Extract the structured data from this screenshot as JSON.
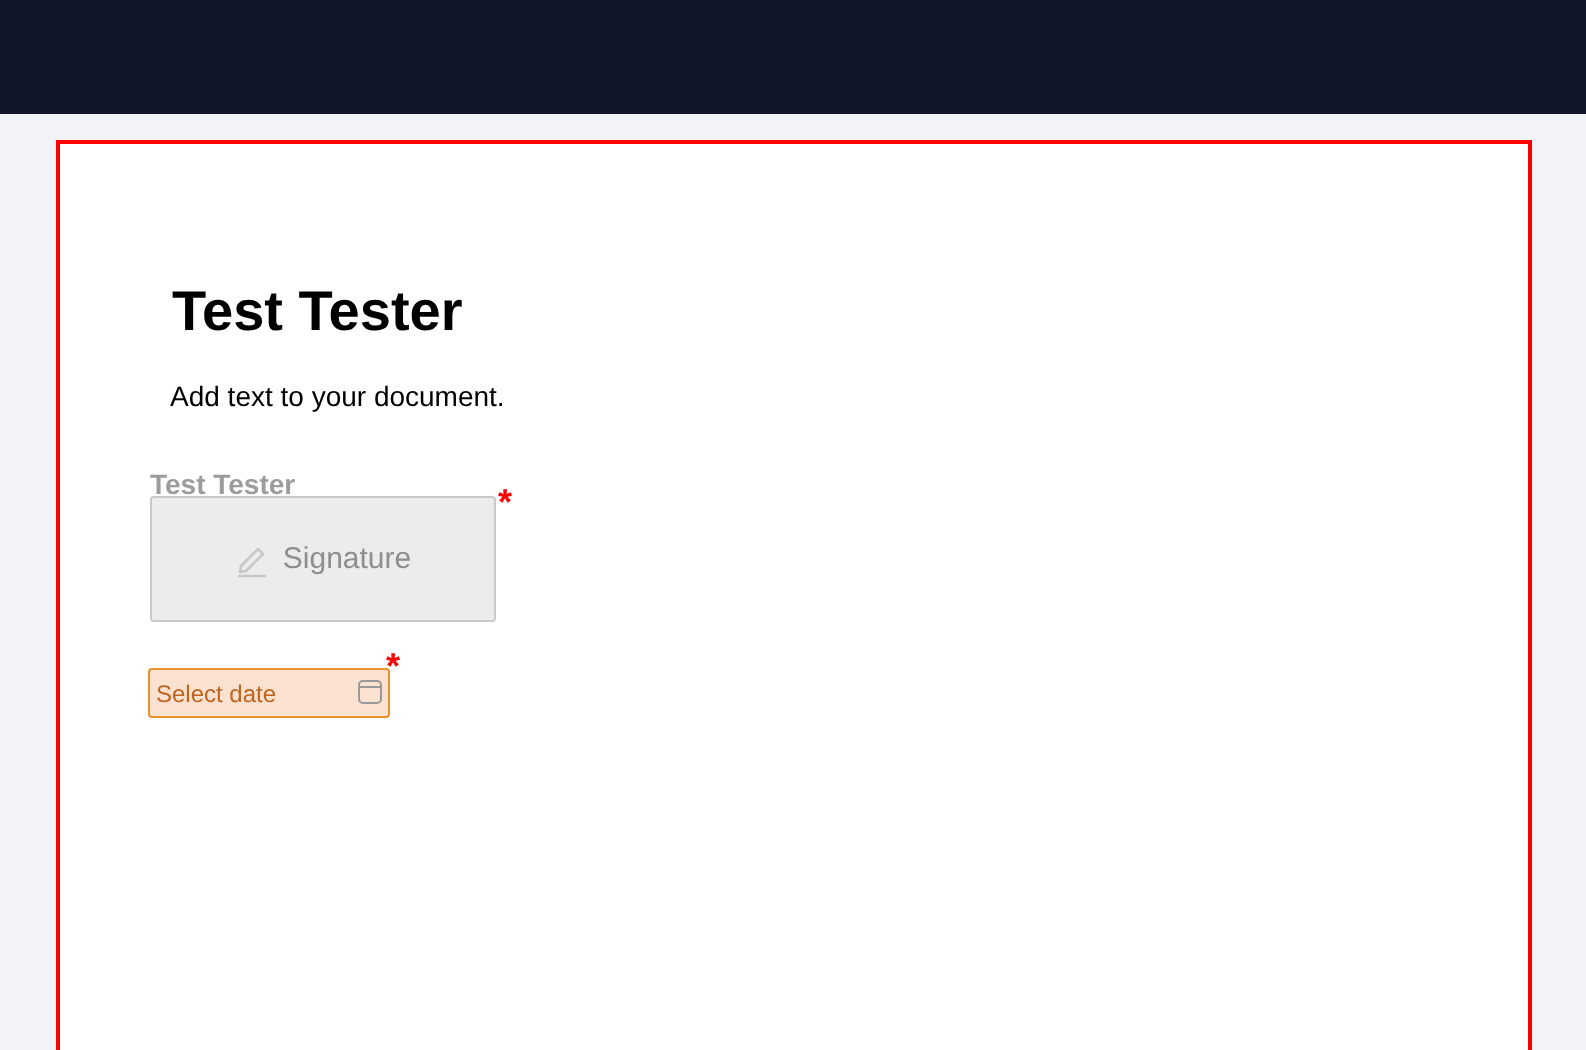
{
  "document": {
    "title": "Test Tester",
    "text": "Add text to your document.",
    "signature": {
      "signer": "Test Tester",
      "label": "Signature",
      "required_mark": "*"
    },
    "date_field": {
      "placeholder": "Select date",
      "required_mark": "*"
    }
  }
}
